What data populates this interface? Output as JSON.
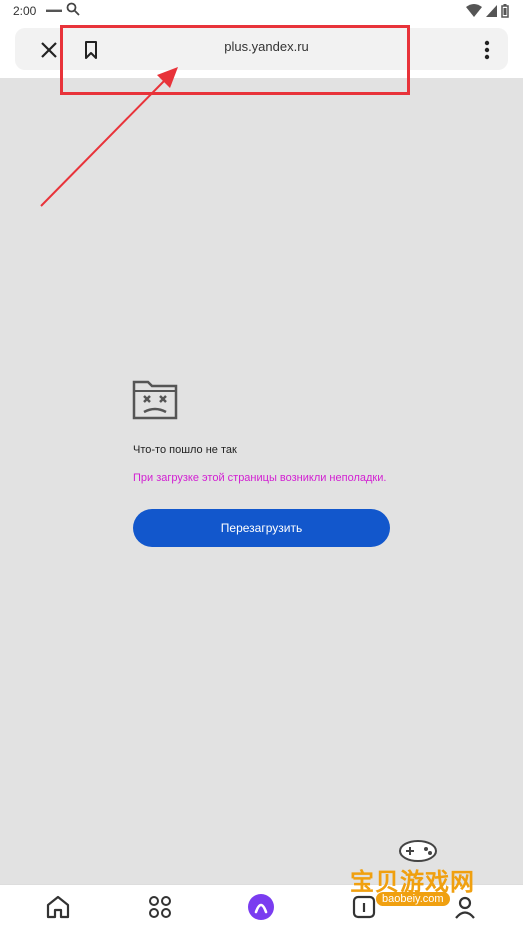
{
  "status_bar": {
    "time": "2:00",
    "icons": [
      "notification-icon",
      "search-icon",
      "wifi-icon",
      "battery-icon"
    ]
  },
  "browser": {
    "url": "plus.yandex.ru",
    "icons": [
      "close-icon",
      "bookmark-icon",
      "more-vertical-icon"
    ]
  },
  "error": {
    "title": "Что-то пошло не так",
    "description": "При загрузке этой страницы возникли неполадки.",
    "reload_label": "Перезагрузить",
    "icon": "broken-folder-icon"
  },
  "bottom_nav": {
    "items": [
      "home-icon",
      "apps-icon",
      "alice-icon",
      "tabs-icon",
      "profile-icon"
    ]
  },
  "watermark": {
    "text": "宝贝游戏网",
    "url": "baobeiy.com"
  },
  "colors": {
    "accent": "#1257cc",
    "error_text": "#d21fd2",
    "annotation": "#e8333a",
    "alice": "#7a3cf0"
  }
}
